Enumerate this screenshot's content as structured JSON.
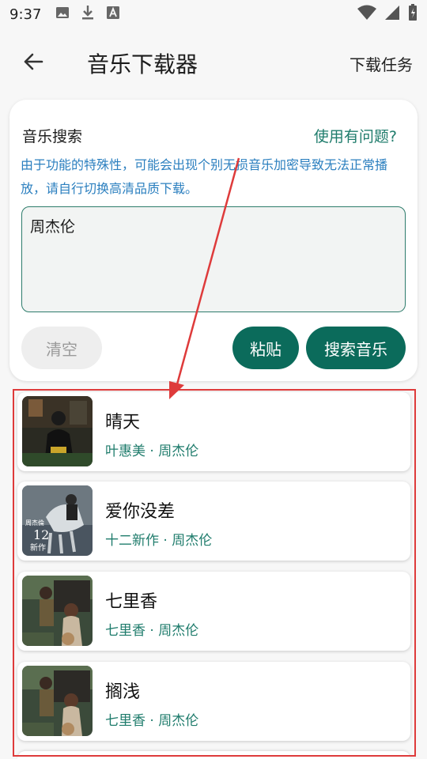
{
  "status_bar": {
    "time": "9:37",
    "left_icons": [
      "image-icon",
      "download-icon",
      "font-icon"
    ],
    "right_icons": [
      "wifi-icon",
      "signal-icon",
      "battery-icon"
    ]
  },
  "app_bar": {
    "title": "音乐下载器",
    "action": "下载任务"
  },
  "search_card": {
    "title": "音乐搜索",
    "help": "使用有问题?",
    "notice": "由于功能的特殊性，可能会出现个别无损音乐加密导致无法正常播放，请自行切换高清品质下载。",
    "input_value": "周杰伦",
    "clear_label": "清空",
    "paste_label": "粘贴",
    "search_label": "搜索音乐"
  },
  "results": [
    {
      "title": "晴天",
      "subtitle": "叶惠美 · 周杰伦"
    },
    {
      "title": "爱你没差",
      "subtitle": "十二新作 · 周杰伦"
    },
    {
      "title": "七里香",
      "subtitle": "七里香 · 周杰伦"
    },
    {
      "title": "搁浅",
      "subtitle": "七里香 · 周杰伦"
    }
  ],
  "cover_art": {
    "cover_2_text_line1": "周杰倫",
    "cover_2_text_line2": "12",
    "cover_2_text_line3": "新作"
  },
  "colors": {
    "accent": "#0b6b5b",
    "link": "#1f7c6c",
    "notice": "#2b7fbf",
    "annotation": "#de3b3b"
  }
}
